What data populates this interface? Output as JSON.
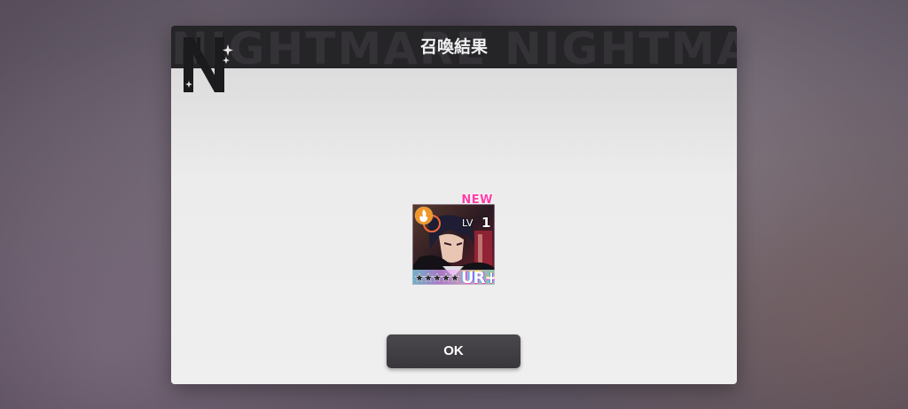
{
  "dialog": {
    "title": "召喚結果",
    "header_pattern": "NIGHTMARE NIGHTMARE NIGHTMARE",
    "logo_letter": "N",
    "ok_label": "OK"
  },
  "result_card": {
    "new_badge": "NEW",
    "level_label": "LV",
    "level_value": "1",
    "rarity": "UR+",
    "element_icon": "fire-icon",
    "stars": 5
  },
  "colors": {
    "header_bg": "#252427",
    "body_bg": "#ececec",
    "button_bg": "#3f3d42",
    "new_badge": "#ff3da8"
  }
}
